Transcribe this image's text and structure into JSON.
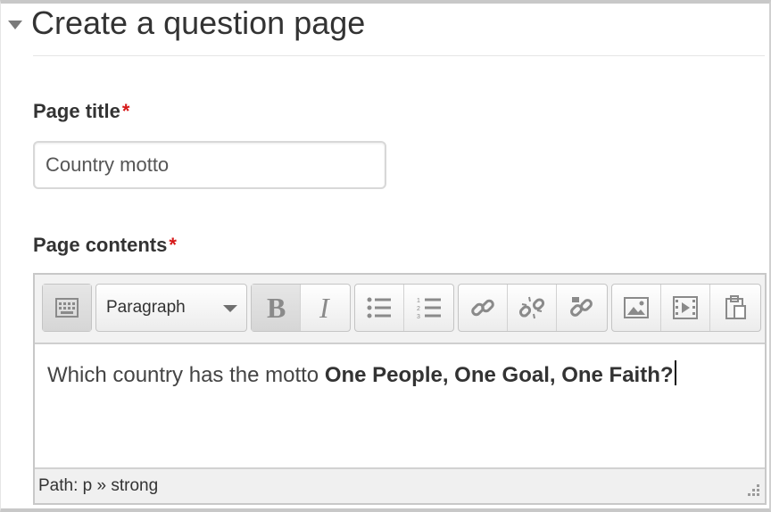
{
  "section": {
    "title": "Create a question page"
  },
  "page_title": {
    "label": "Page title",
    "required_mark": "*",
    "value": "Country motto"
  },
  "page_contents": {
    "label": "Page contents",
    "required_mark": "*"
  },
  "toolbar": {
    "format_select": "Paragraph",
    "icons": [
      "toolbar-toggle-icon",
      "bold-icon",
      "italic-icon",
      "bullet-list-icon",
      "numbered-list-icon",
      "link-icon",
      "unlink-icon",
      "manage-files-icon",
      "image-icon",
      "media-icon",
      "paste-icon"
    ]
  },
  "editor": {
    "text_plain": "Which country has the motto ",
    "text_bold": "One People, One Goal, One Faith?"
  },
  "statusbar": {
    "path": "Path: p » strong"
  },
  "colors": {
    "required": "#d61818",
    "frame": "#c8c8c8"
  }
}
